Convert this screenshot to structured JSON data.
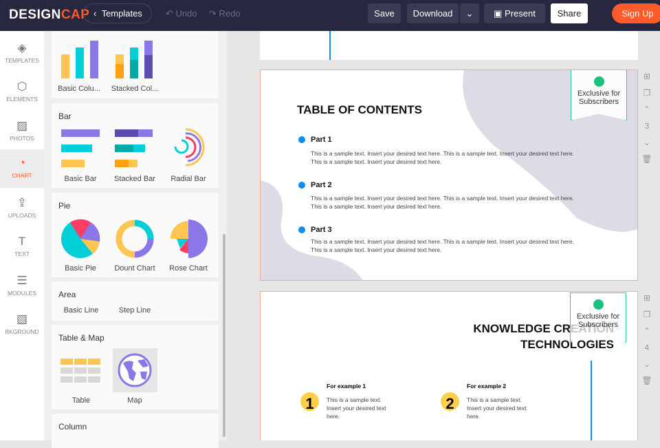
{
  "header": {
    "logo_a": "DESIGN",
    "logo_b": "CAP",
    "templates": "Templates",
    "undo": "Undo",
    "redo": "Redo",
    "save": "Save",
    "download": "Download",
    "present": "Present",
    "share": "Share",
    "signup": "Sign Up"
  },
  "rail": [
    {
      "label": "TEMPLATES",
      "icon": "◈"
    },
    {
      "label": "ELEMENTS",
      "icon": "⬡"
    },
    {
      "label": "PHOTOS",
      "icon": "▨"
    },
    {
      "label": "CHART",
      "icon": "◔"
    },
    {
      "label": "UPLOADS",
      "icon": "⇪"
    },
    {
      "label": "TEXT",
      "icon": "T"
    },
    {
      "label": "MODULES",
      "icon": "☰"
    },
    {
      "label": "BKGROUND",
      "icon": "▧"
    }
  ],
  "panel": {
    "column_items": [
      "Basic Colu...",
      "Stacked Col..."
    ],
    "bar": {
      "title": "Bar",
      "items": [
        "Basic Bar",
        "Stacked Bar",
        "Radial Bar"
      ]
    },
    "pie": {
      "title": "Pie",
      "items": [
        "Basic Pie",
        "Dount Chart",
        "Rose Chart"
      ]
    },
    "area": {
      "title": "Area",
      "items": [
        "Basic Line",
        "Step Line"
      ]
    },
    "tablemap": {
      "title": "Table & Map",
      "items": [
        "Table",
        "Map"
      ]
    },
    "column": {
      "title": "Column"
    }
  },
  "page3": {
    "title": "TABLE OF CONTENTS",
    "parts": [
      {
        "name": "Part 1",
        "text": "This is a sample text. Insert your desired text here. This is a sample text. Insert your desired text here. This is a sample text. Insert your desired text here."
      },
      {
        "name": "Part 2",
        "text": "This is a sample text. Insert your desired text here. This is a sample text. Insert your desired text here. This is a sample text. Insert your desired text here."
      },
      {
        "name": "Part 3",
        "text": "This is a sample text. Insert your desired text here. This is a sample text. Insert your desired text here. This is a sample text. Insert your desired text here."
      }
    ],
    "badge": "Exclusive for Subscribers",
    "number": "3"
  },
  "page4": {
    "title1": "KNOWLEDGE CREATION",
    "title2": "TECHNOLOGIES",
    "examples": [
      {
        "num": "1",
        "title": "For example 1",
        "text": "This is a sample text. Insert your desired text here."
      },
      {
        "num": "2",
        "title": "For example 2",
        "text": "This is a sample text. Insert your desired text here."
      }
    ],
    "badge": "Exclusive for Subscribers",
    "number": "4"
  }
}
